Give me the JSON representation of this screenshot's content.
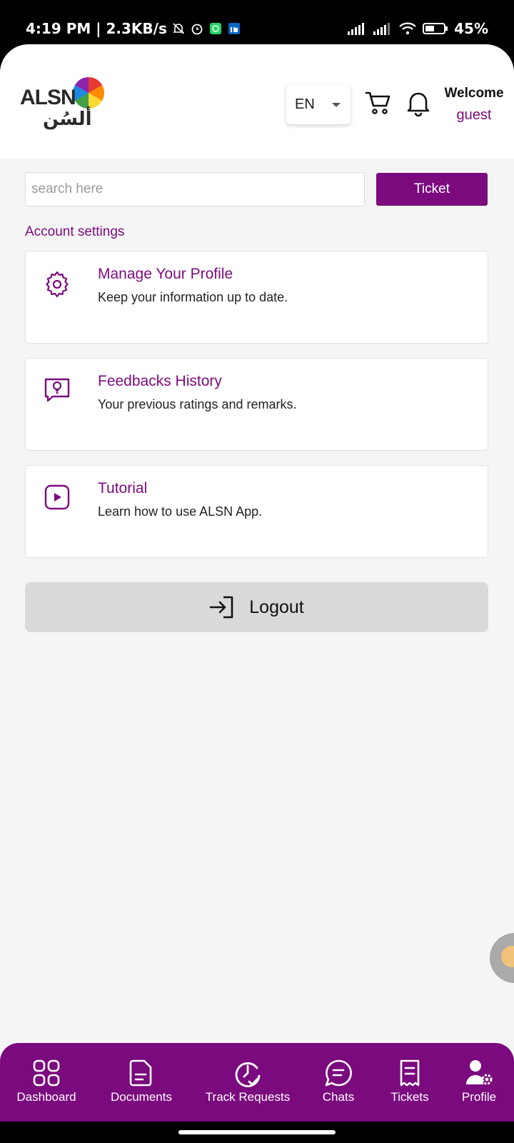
{
  "status_bar": {
    "time_speed": "4:19 PM | 2.3KB/s",
    "battery": "45%"
  },
  "header": {
    "logo_text": "ALSN",
    "logo_arabic": "ألسُن",
    "language": "EN",
    "welcome_title": "Welcome",
    "welcome_user": "guest"
  },
  "search": {
    "placeholder": "search here",
    "value": ""
  },
  "ticket_button": "Ticket",
  "account_section": {
    "title": "Account settings",
    "items": [
      {
        "icon": "gear-icon",
        "title": "Manage Your Profile",
        "subtitle": "Keep your information up to date."
      },
      {
        "icon": "feedback-icon",
        "title": "Feedbacks History",
        "subtitle": "Your previous ratings and remarks."
      },
      {
        "icon": "play-icon",
        "title": "Tutorial",
        "subtitle": "Learn how to use ALSN App."
      }
    ]
  },
  "logout_label": "Logout",
  "bottom_nav": [
    {
      "icon": "dashboard-icon",
      "label": "Dashboard"
    },
    {
      "icon": "document-icon",
      "label": "Documents"
    },
    {
      "icon": "track-icon",
      "label": "Track Requests"
    },
    {
      "icon": "chat-icon",
      "label": "Chats"
    },
    {
      "icon": "ticket-icon",
      "label": "Tickets"
    },
    {
      "icon": "profile-icon",
      "label": "Profile"
    }
  ],
  "colors": {
    "brand": "#7b0a7e",
    "background": "#f5f5f5",
    "logout_bg": "#d9d9d9"
  }
}
